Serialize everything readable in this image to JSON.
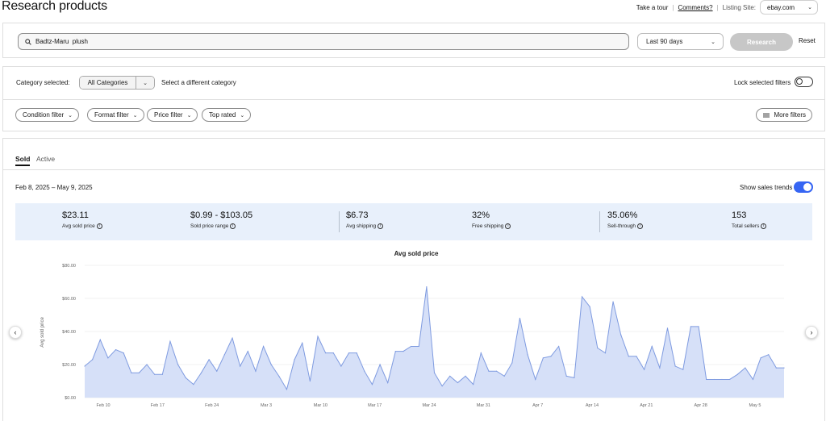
{
  "header": {
    "title": "Research products",
    "take_tour": "Take a tour",
    "comments": "Comments?",
    "listing_site_label": "Listing Site:",
    "listing_site_value": "ebay.com"
  },
  "search": {
    "query": "Badtz-Maru  plush",
    "date_range_option": "Last 90 days",
    "research_label": "Research",
    "reset_label": "Reset"
  },
  "category": {
    "label": "Category selected:",
    "selected": "All Categories",
    "select_different": "Select a different category",
    "lock_label": "Lock selected filters"
  },
  "filters": {
    "condition": "Condition filter",
    "format": "Format filter",
    "price": "Price filter",
    "top_rated": "Top rated",
    "more": "More filters"
  },
  "tabs": {
    "sold": "Sold",
    "active": "Active"
  },
  "results": {
    "date_range": "Feb 8, 2025 – May 9, 2025",
    "show_trends_label": "Show sales trends"
  },
  "stats": [
    {
      "value": "$23.11",
      "label": "Avg sold price"
    },
    {
      "value": "$0.99 - $103.05",
      "label": "Sold price range"
    },
    {
      "value": "$6.73",
      "label": "Avg shipping"
    },
    {
      "value": "32%",
      "label": "Free shipping"
    },
    {
      "value": "35.06%",
      "label": "Sell-through"
    },
    {
      "value": "153",
      "label": "Total sellers"
    }
  ],
  "colors": {
    "accent": "#3665f3",
    "area_fill": "#d6e0f8",
    "area_line": "#7f9be0",
    "stats_bg": "#e8f0fb"
  },
  "chart_data": {
    "type": "area",
    "title": "Avg sold price",
    "ylabel": "Avg sold price",
    "xlabel": "",
    "ylim": [
      0,
      80
    ],
    "y_ticks": [
      "$0.00",
      "$20.00",
      "$40.00",
      "$60.00",
      "$80.00"
    ],
    "x_ticks": [
      "Feb 10",
      "Feb 17",
      "Feb 24",
      "Mar 3",
      "Mar 10",
      "Mar 17",
      "Mar 24",
      "Mar 31",
      "Apr 7",
      "Apr 14",
      "Apr 21",
      "Apr 28",
      "May 5"
    ],
    "grid": true,
    "series": [
      {
        "values": [
          19,
          23,
          35,
          24,
          29,
          27,
          15,
          15,
          20,
          14,
          14,
          34,
          20,
          12,
          8,
          15,
          23,
          16,
          26,
          36,
          19,
          28,
          16,
          31,
          20,
          13,
          5,
          23,
          33,
          10,
          37,
          27,
          27,
          19,
          27,
          27,
          16,
          8,
          20,
          9,
          28,
          28,
          31,
          31,
          67,
          15,
          7,
          13,
          9,
          13,
          8,
          27,
          16,
          16,
          13,
          21,
          48,
          26,
          11,
          24,
          25,
          31,
          13,
          12,
          61,
          55,
          30,
          27,
          58,
          38,
          25,
          25,
          17,
          31,
          18,
          42,
          19,
          17,
          43,
          43,
          11,
          11,
          11,
          11,
          14,
          18,
          11,
          24,
          26,
          18,
          18
        ]
      }
    ]
  }
}
